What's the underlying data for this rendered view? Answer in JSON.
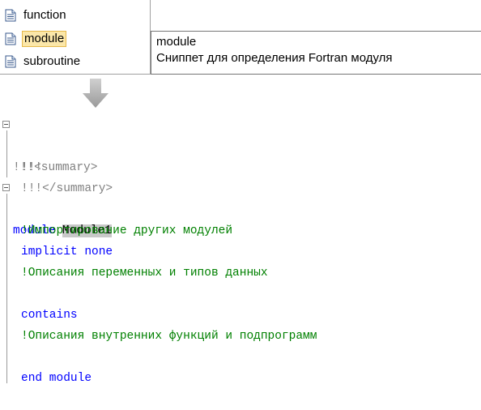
{
  "snippets": {
    "items": [
      {
        "label": "function",
        "icon": "snippet-doc-icon",
        "selected": false
      },
      {
        "label": "module",
        "icon": "snippet-doc-icon",
        "selected": true
      },
      {
        "label": "subroutine",
        "icon": "snippet-doc-icon",
        "selected": false
      }
    ]
  },
  "tooltip": {
    "title": "module",
    "description": "Сниппет для определения Fortran модуля"
  },
  "arrow": {
    "icon": "arrow-down-icon"
  },
  "code": {
    "summary_open": "!!!<summary>",
    "summary_body": "!!!",
    "summary_close": "!!!</summary>",
    "module_keyword": "module",
    "module_name": "Module1",
    "comment_imports": "!Импортирование других модулей",
    "implicit_none": "implicit none",
    "comment_vars": "!Описания переменных и типов данных",
    "contains_keyword": "contains",
    "comment_subs": "!Описания внутренних функций и подпрограмм",
    "end_module": "end module"
  },
  "colors": {
    "keyword": "#0000ff",
    "comment": "#008000",
    "doc_comment": "#808080",
    "selection_bg": "#fbe7a9",
    "identifier_highlight": "#c8c8c8"
  }
}
